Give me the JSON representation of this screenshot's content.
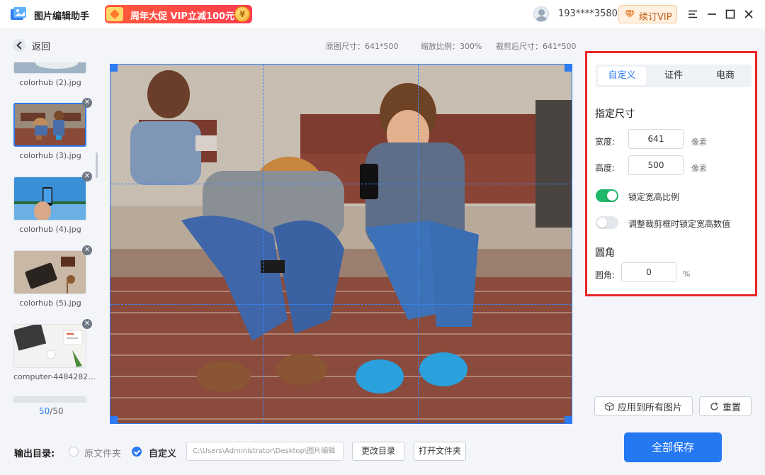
{
  "app": {
    "title": "图片编辑助手"
  },
  "promo": {
    "text": "周年大促 VIP立减100元",
    "coin": "¥"
  },
  "user": {
    "phone": "193****3580"
  },
  "vip_button": {
    "label": "续订VIP"
  },
  "toolbar": {
    "back_label": "返回",
    "original_size": "原图尺寸：641*500",
    "zoom": "缩放比例：300%",
    "cropped_size": "裁剪后尺寸：641*500"
  },
  "thumbnails": [
    {
      "label": "colorhub (2).jpg",
      "icon": "photo-thumb"
    },
    {
      "label": "colorhub (3).jpg",
      "icon": "photo-thumb",
      "selected": true
    },
    {
      "label": "colorhub (4).jpg",
      "icon": "photo-thumb"
    },
    {
      "label": "colorhub (5).jpg",
      "icon": "photo-thumb"
    },
    {
      "label": "computer-4484282...",
      "icon": "photo-thumb"
    }
  ],
  "pagination": {
    "current": "50",
    "separator": "/",
    "total": "50"
  },
  "panel": {
    "tabs": [
      "自定义",
      "证件",
      "电商"
    ],
    "active_tab": "自定义",
    "size_section": "指定尺寸",
    "width_label": "宽度:",
    "width_value": "641",
    "height_label": "高度:",
    "height_value": "500",
    "unit": "像素",
    "lock_ratio_label": "锁定宽高比例",
    "lock_ratio_on": true,
    "lock_values_label": "调整裁剪框时锁定宽高数值",
    "lock_values_on": false,
    "corner_section": "圆角",
    "corner_label": "圆角:",
    "corner_value": "0",
    "corner_unit": "%"
  },
  "actions": {
    "apply_all": "应用到所有图片",
    "reset": "重置"
  },
  "output": {
    "label": "输出目录:",
    "option_original": "原文件夹",
    "option_custom": "自定义",
    "path": "C:\\Users\\Administrator\\Desktop\\图片编辑",
    "change_dir": "更改目录",
    "open_folder": "打开文件夹",
    "save_all": "全部保存"
  },
  "colors": {
    "accent": "#2d7bf0",
    "highlight_border": "#e8262a",
    "toggle_on": "#1fb86a"
  }
}
